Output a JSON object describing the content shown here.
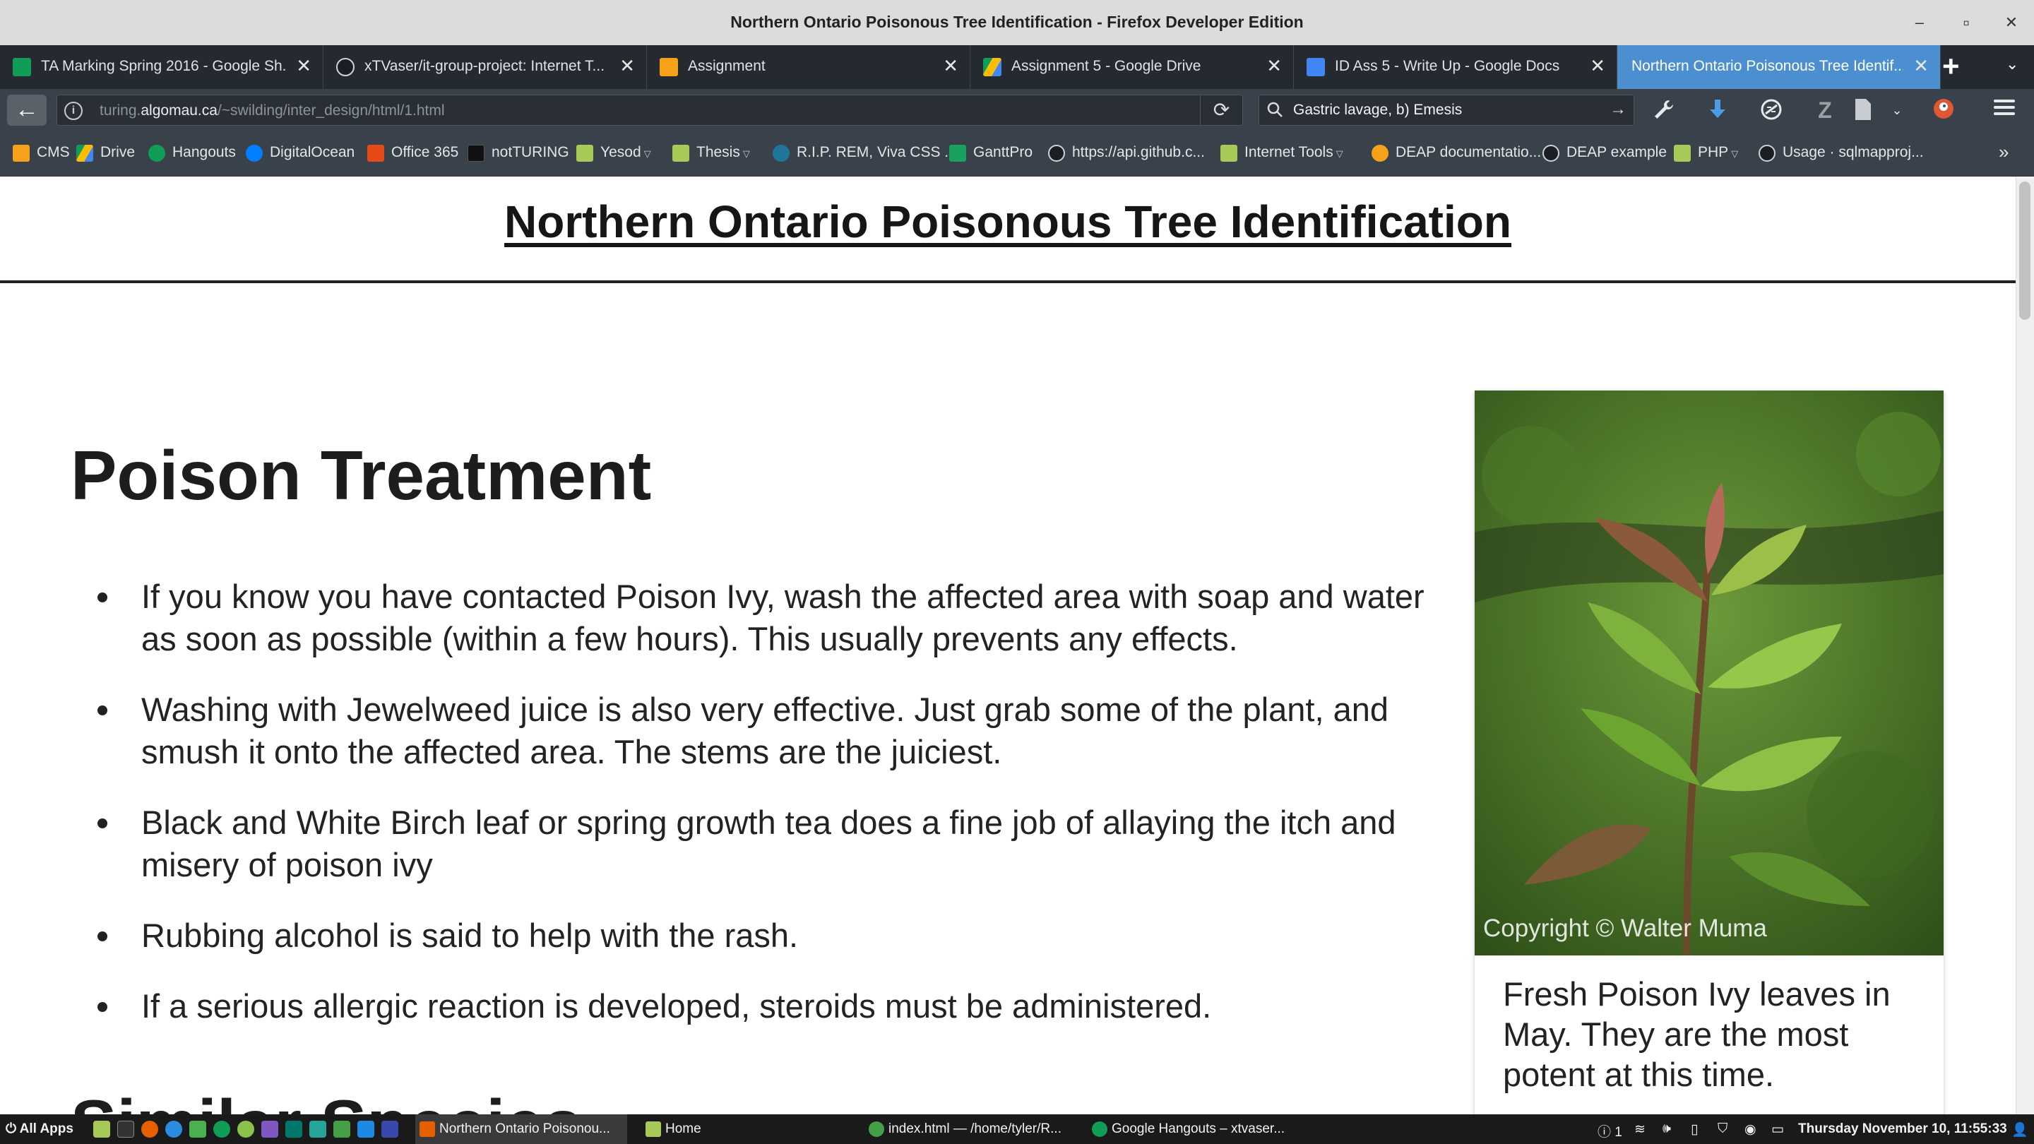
{
  "window": {
    "title": "Northern Ontario Poisonous Tree Identification - Firefox Developer Edition",
    "minimize": "–",
    "maximize": "▫",
    "close": "✕"
  },
  "tabs": [
    {
      "label": "TA Marking Spring 2016 - Google Sh...",
      "favicon_color": "#0f9d58",
      "close": "✕"
    },
    {
      "label": "xTVaser/it-group-project: Internet T...",
      "favicon_color": "#1b1f23",
      "close": "✕"
    },
    {
      "label": "Assignment",
      "favicon_color": "#f6a11a",
      "close": "✕"
    },
    {
      "label": "Assignment 5 - Google Drive",
      "favicon_color": "#fbbc04",
      "close": "✕"
    },
    {
      "label": "ID Ass 5 - Write Up - Google Docs",
      "favicon_color": "#4285f4",
      "close": "✕"
    },
    {
      "label": "Northern Ontario Poisonous Tree Identif...",
      "favicon_color": "#4c8fd1",
      "close": "✕",
      "active": true
    }
  ],
  "toolbar": {
    "new_tab": "+",
    "tab_list": "⌄",
    "back": "←",
    "info": "i",
    "url_prefix": "turing.",
    "url_domain": "algomau.ca",
    "url_path": "/~swilding/inter_design/html/1.html",
    "reload": "⟳",
    "search_value": "Gastric lavage, b) Emesis",
    "search_icon": "⚲",
    "search_go": "→"
  },
  "bookmarks": [
    {
      "label": "CMS",
      "icon": "cms-icon",
      "color": "#f6a11a"
    },
    {
      "label": "Drive",
      "icon": "drive-icon",
      "color": "#fbbc04"
    },
    {
      "label": "Hangouts",
      "icon": "hangouts-icon",
      "color": "#0f9d58"
    },
    {
      "label": "DigitalOcean",
      "icon": "digitalocean-icon",
      "color": "#0080ff"
    },
    {
      "label": "Office 365",
      "icon": "office-icon",
      "color": "#e64a19"
    },
    {
      "label": "notTURING",
      "icon": "notturing-icon",
      "color": "#111111"
    },
    {
      "label": "Yesod",
      "icon": "folder-icon",
      "color": "#a7c957",
      "dropdown": true
    },
    {
      "label": "Thesis",
      "icon": "folder-icon",
      "color": "#a7c957",
      "dropdown": true
    },
    {
      "label": "R.I.P. REM, Viva CSS ...",
      "icon": "wordpress-icon",
      "color": "#21759b"
    },
    {
      "label": "GanttPro",
      "icon": "ganttpro-icon",
      "color": "#19a15f"
    },
    {
      "label": "https://api.github.c...",
      "icon": "github-icon",
      "color": "#1b1f23"
    },
    {
      "label": "Internet Tools",
      "icon": "folder-icon",
      "color": "#a7c957",
      "dropdown": true
    },
    {
      "label": "DEAP documentatio...",
      "icon": "deap-icon",
      "color": "#f6a11a"
    },
    {
      "label": "DEAP example",
      "icon": "github-icon",
      "color": "#1b1f23"
    },
    {
      "label": "PHP",
      "icon": "folder-icon",
      "color": "#a7c957",
      "dropdown": true
    },
    {
      "label": "Usage · sqlmapproj...",
      "icon": "github-icon",
      "color": "#1b1f23"
    }
  ],
  "bookmarks_more": "»",
  "page": {
    "site_title": "Northern Ontario Poisonous Tree Identification",
    "treatment_heading": "Poison Treatment",
    "treatment_items": [
      "If you know you have contacted Poison Ivy, wash the affected area with soap and water as soon as possible (within a few hours). This usually prevents any effects.",
      "Washing with Jewelweed juice is also very effective. Just grab some of the plant, and smush it onto the affected area. The stems are the juiciest.",
      "Black and White Birch leaf or spring growth tea does a fine job of allaying the itch and misery of poison ivy",
      "Rubbing alcohol is said to help with the rash.",
      "If a serious allergic reaction is developed, steroids must be administered."
    ],
    "similar_heading": "Similar Species",
    "figure": {
      "copyright": "Copyright © Walter Muma",
      "caption": "Fresh Poison Ivy leaves in May. They are the most potent at this time."
    }
  },
  "taskbar": {
    "all_apps": "All Apps",
    "items": [
      {
        "label": "Northern Ontario Poisonou...",
        "color": "#e66000",
        "active": true
      },
      {
        "label": "Home",
        "color": "#a7c957"
      },
      {
        "label": "index.html — /home/tyler/R...",
        "color": "#43a047"
      },
      {
        "label": "Google Hangouts – xtvaser...",
        "color": "#0f9d58"
      }
    ],
    "notifications": "1",
    "clock": "Thursday November 10, 11:55:33"
  }
}
